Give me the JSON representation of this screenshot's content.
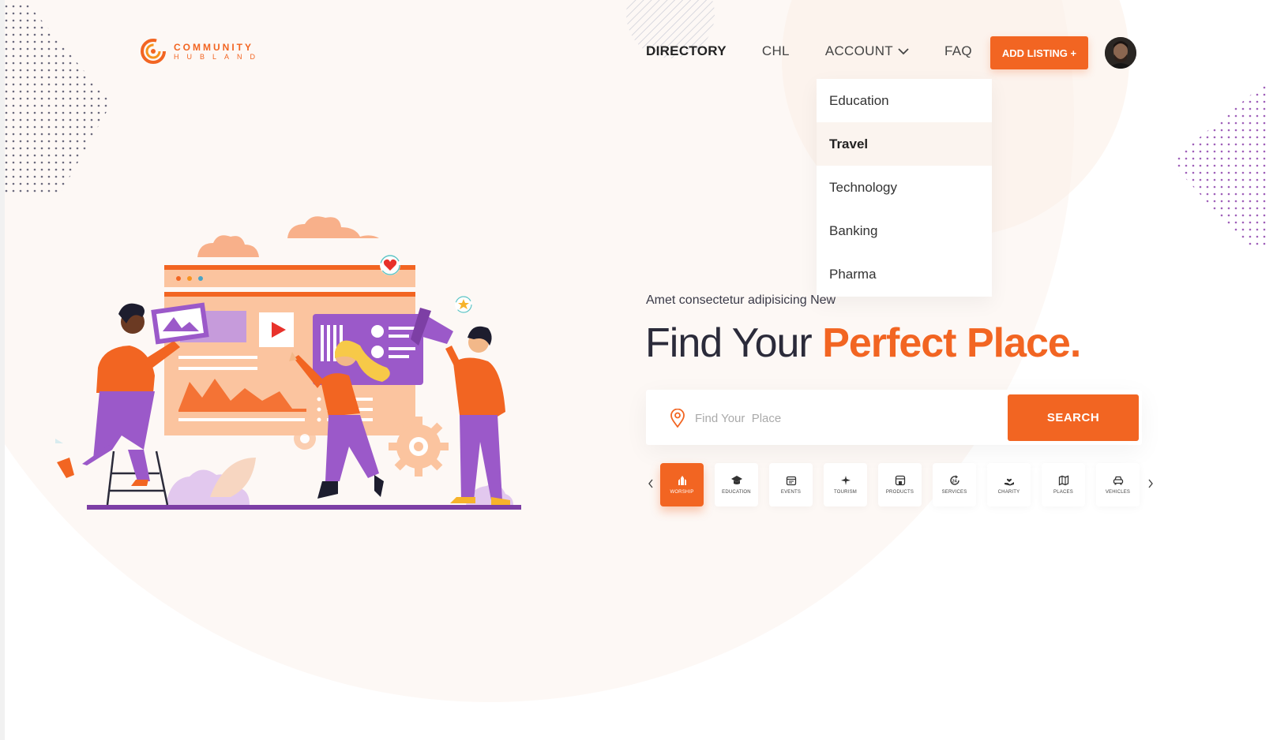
{
  "brand": {
    "line1": "COMMUNITY",
    "line2": "HUBLAND",
    "accent": "#f26522"
  },
  "nav": {
    "items": [
      {
        "label": "DIRECTORY",
        "active": true
      },
      {
        "label": "CHL",
        "active": false
      },
      {
        "label": "ACCOUNT",
        "active": false,
        "dropdown": true
      },
      {
        "label": "FAQ",
        "active": false
      }
    ],
    "add_listing": "ADD LISTING +"
  },
  "dropdown": {
    "items": [
      {
        "label": "Education",
        "selected": false
      },
      {
        "label": "Travel",
        "selected": true
      },
      {
        "label": "Technology",
        "selected": false
      },
      {
        "label": "Banking",
        "selected": false
      },
      {
        "label": "Pharma",
        "selected": false
      }
    ]
  },
  "hero": {
    "tagline": "Amet consectetur adipisicing New",
    "headline_plain": "Find Your ",
    "headline_accent": "Perfect Place."
  },
  "search": {
    "placeholder": "Find Your  Place",
    "value": "",
    "button": "SEARCH"
  },
  "categories": [
    {
      "label": "WORSHIP",
      "icon": "worship-icon",
      "active": true
    },
    {
      "label": "EDUCATION",
      "icon": "graduation-cap-icon",
      "active": false
    },
    {
      "label": "EVENTS",
      "icon": "calendar-icon",
      "active": false
    },
    {
      "label": "TOURISM",
      "icon": "plane-icon",
      "active": false
    },
    {
      "label": "PRODUCTS",
      "icon": "shop-icon",
      "active": false
    },
    {
      "label": "SERVICES",
      "icon": "24h-service-icon",
      "active": false
    },
    {
      "label": "CHARITY",
      "icon": "charity-hand-icon",
      "active": false
    },
    {
      "label": "PLACES",
      "icon": "map-icon",
      "active": false
    },
    {
      "label": "VEHICLES",
      "icon": "car-icon",
      "active": false
    }
  ],
  "colors": {
    "accent": "#f26522",
    "purple": "#9b59c9",
    "text": "#2b2b3a"
  }
}
